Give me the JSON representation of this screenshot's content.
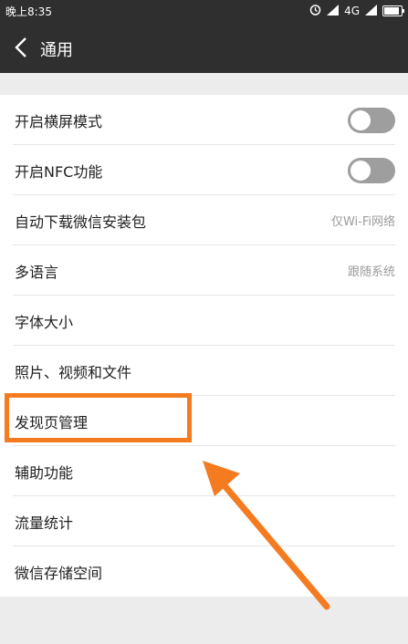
{
  "status_bar": {
    "time": "晚上8:35",
    "network": "4G",
    "battery_level": 0.9,
    "icons": [
      "alarm-icon",
      "signal-icon",
      "battery-icon"
    ]
  },
  "header": {
    "title": "通用",
    "back_icon": "chevron-left-icon"
  },
  "settings": {
    "items": [
      {
        "label": "开启横屏模式",
        "type": "toggle",
        "enabled": false
      },
      {
        "label": "开启NFC功能",
        "type": "toggle",
        "enabled": false
      },
      {
        "label": "自动下载微信安装包",
        "value": "仅Wi-Fi网络"
      },
      {
        "label": "多语言",
        "value": "跟随系统"
      },
      {
        "label": "字体大小"
      },
      {
        "label": "照片、视频和文件"
      },
      {
        "label": "发现页管理",
        "highlighted": true
      },
      {
        "label": "辅助功能"
      },
      {
        "label": "流量统计"
      },
      {
        "label": "微信存储空间"
      }
    ]
  },
  "colors": {
    "header_bg": "#2f2f2f",
    "page_bg": "#ececec",
    "highlight": "#f47b20",
    "toggle_off": "#9e9e9e"
  }
}
